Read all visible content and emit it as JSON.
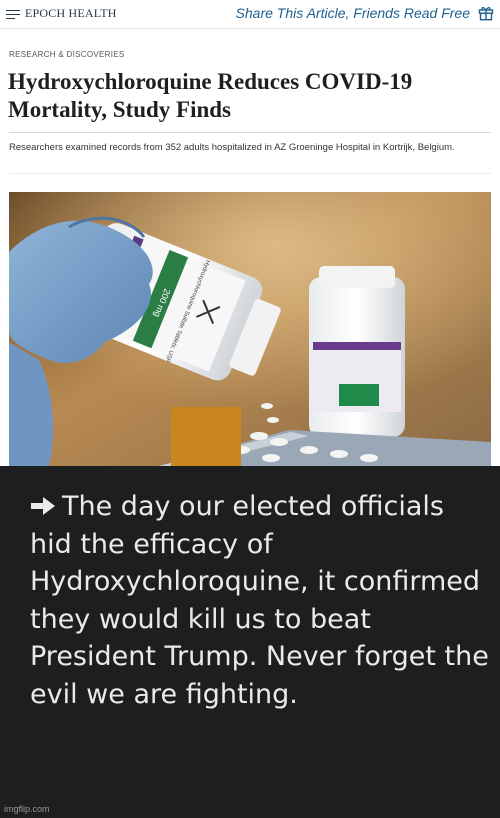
{
  "header": {
    "brand": "EPOCH HEALTH",
    "share_text": "Share This Article, Friends Read Free",
    "icons": [
      "menu-icon",
      "gift-icon"
    ]
  },
  "article": {
    "kicker": "RESEARCH & DISCOVERIES",
    "headline": "Hydroxychloroquine Reduces COVID-19 Mortality, Study Finds",
    "dek": "Researchers examined records from 352 adults hospitalized in AZ Groeninge Hospital in Kortrijk, Belgium.",
    "photo": {
      "bottle_label_dose": "200 mg",
      "bottle_label_drug": "Hydroxychloroquine Sulfate Tablets, USP"
    }
  },
  "meme": {
    "quote": "The day our elected officials hid the efficacy of Hydroxychloroquine, it confirmed they would kill us to beat President Trump. Never forget the evil we are fighting.",
    "icon": "arrow-right-icon",
    "watermark": "imgflip.com"
  }
}
